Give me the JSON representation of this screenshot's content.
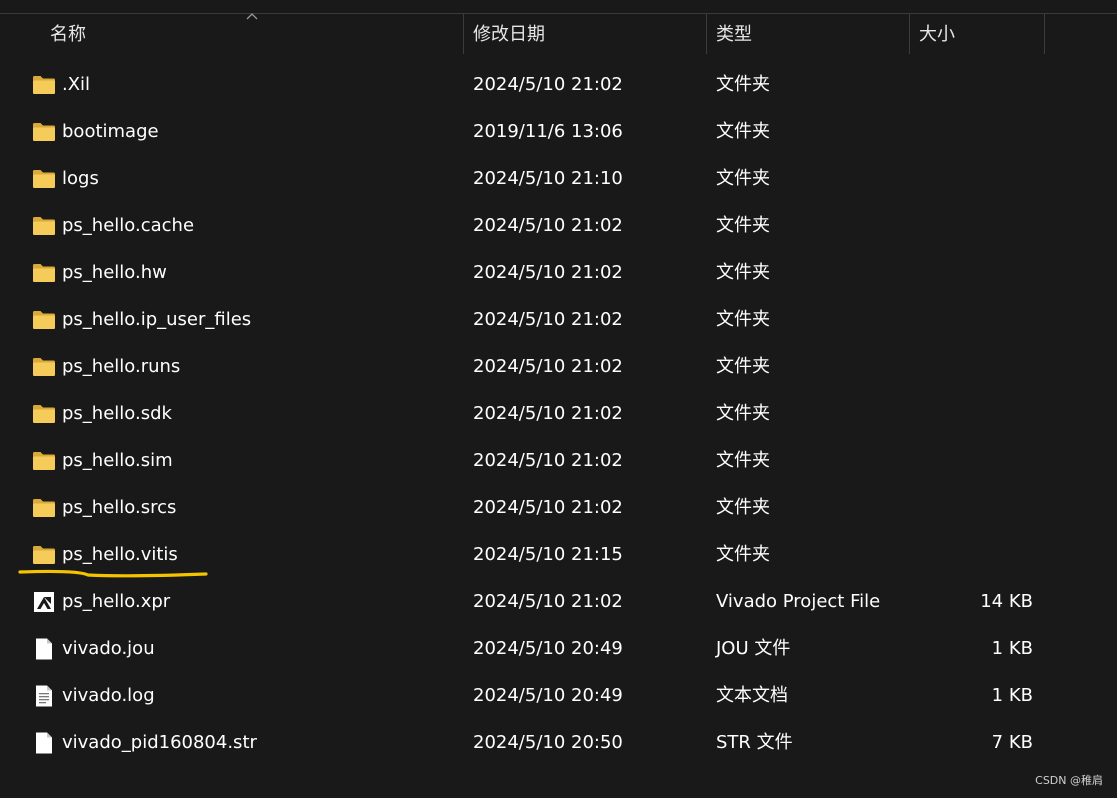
{
  "columns": {
    "name": "名称",
    "date": "修改日期",
    "type": "类型",
    "size": "大小"
  },
  "files": [
    {
      "name": ".Xil",
      "date": "2024/5/10 21:02",
      "type": "文件夹",
      "size": "",
      "icon": "folder-icon"
    },
    {
      "name": "bootimage",
      "date": "2019/11/6 13:06",
      "type": "文件夹",
      "size": "",
      "icon": "folder-icon"
    },
    {
      "name": "logs",
      "date": "2024/5/10 21:10",
      "type": "文件夹",
      "size": "",
      "icon": "folder-icon"
    },
    {
      "name": "ps_hello.cache",
      "date": "2024/5/10 21:02",
      "type": "文件夹",
      "size": "",
      "icon": "folder-icon"
    },
    {
      "name": "ps_hello.hw",
      "date": "2024/5/10 21:02",
      "type": "文件夹",
      "size": "",
      "icon": "folder-icon"
    },
    {
      "name": "ps_hello.ip_user_files",
      "date": "2024/5/10 21:02",
      "type": "文件夹",
      "size": "",
      "icon": "folder-icon"
    },
    {
      "name": "ps_hello.runs",
      "date": "2024/5/10 21:02",
      "type": "文件夹",
      "size": "",
      "icon": "folder-icon"
    },
    {
      "name": "ps_hello.sdk",
      "date": "2024/5/10 21:02",
      "type": "文件夹",
      "size": "",
      "icon": "folder-icon"
    },
    {
      "name": "ps_hello.sim",
      "date": "2024/5/10 21:02",
      "type": "文件夹",
      "size": "",
      "icon": "folder-icon"
    },
    {
      "name": "ps_hello.srcs",
      "date": "2024/5/10 21:02",
      "type": "文件夹",
      "size": "",
      "icon": "folder-icon"
    },
    {
      "name": "ps_hello.vitis",
      "date": "2024/5/10 21:15",
      "type": "文件夹",
      "size": "",
      "icon": "folder-icon"
    },
    {
      "name": "ps_hello.xpr",
      "date": "2024/5/10 21:02",
      "type": "Vivado Project File",
      "size": "14 KB",
      "icon": "vivado-project-icon"
    },
    {
      "name": "vivado.jou",
      "date": "2024/5/10 20:49",
      "type": "JOU 文件",
      "size": "1 KB",
      "icon": "file-icon"
    },
    {
      "name": "vivado.log",
      "date": "2024/5/10 20:49",
      "type": "文本文档",
      "size": "1 KB",
      "icon": "text-file-icon"
    },
    {
      "name": "vivado_pid160804.str",
      "date": "2024/5/10 20:50",
      "type": "STR 文件",
      "size": "7 KB",
      "icon": "file-icon"
    }
  ],
  "highlight": {
    "row_name": "ps_hello.vitis",
    "color": "#f5c400"
  },
  "colors": {
    "background": "#191919",
    "folder": "#f2c94c",
    "text": "#ffffff"
  },
  "watermark": "CSDN @稚肩"
}
